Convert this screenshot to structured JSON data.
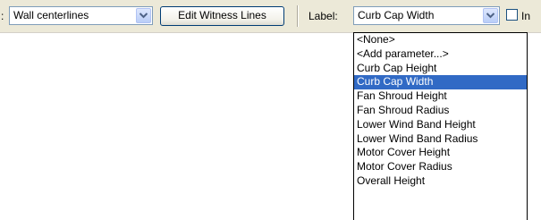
{
  "toolbar": {
    "prefix_text": ":",
    "location_combo_value": "Wall centerlines",
    "edit_witness_button_label": "Edit Witness Lines",
    "label_caption": "Label:",
    "label_combo_value": "Curb Cap Width",
    "trailing_checkbox_label": "In"
  },
  "label_dropdown": {
    "items": [
      "<None>",
      "<Add parameter...>",
      "Curb Cap Height",
      "Curb Cap Width",
      "Fan Shroud Height",
      "Fan Shroud Radius",
      "Lower Wind Band Height",
      "Lower Wind Band Radius",
      "Motor Cover Height",
      "Motor Cover Radius",
      "Overall Height"
    ],
    "selected_index": 3
  },
  "icons": {
    "combo_arrow": "chevron-down-icon"
  },
  "colors": {
    "toolbar_bg": "#ece9d8",
    "selection_bg": "#316ac5",
    "selection_text": "#ffffff",
    "combo_border": "#7f9db9"
  }
}
